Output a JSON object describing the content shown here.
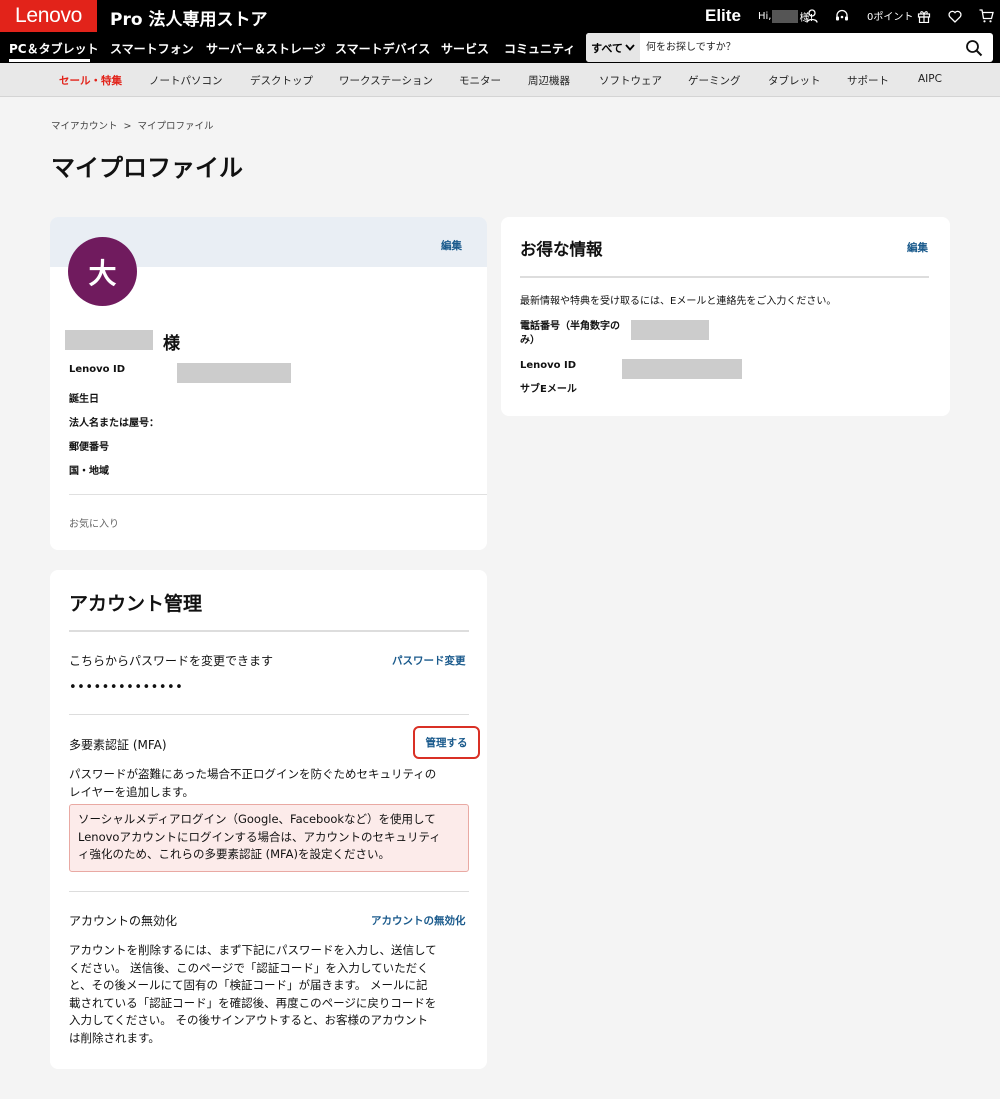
{
  "header": {
    "logo": "Lenovo",
    "store_title": "Pro 法人専用ストア",
    "elite": "Elite",
    "greeting_prefix": "Hi,",
    "greeting_suffix": "様!",
    "points": "0ポイント"
  },
  "nav": {
    "items": [
      "PC＆タブレット",
      "スマートフォン",
      "サーバー＆ストレージ",
      "スマートデバイス",
      "サービス",
      "コミュニティ"
    ]
  },
  "search": {
    "scope": "すべて",
    "placeholder": "何をお探しですか？"
  },
  "categories": [
    "セール・特集",
    "ノートパソコン",
    "デスクトップ",
    "ワークステーション",
    "モニター",
    "周辺機器",
    "ソフトウェア",
    "ゲーミング",
    "タブレット",
    "サポート",
    "AIPC"
  ],
  "breadcrumb": {
    "parent": "マイアカウント",
    "separator": ">",
    "current": "マイプロファイル"
  },
  "page_title": "マイプロファイル",
  "profile": {
    "edit": "編集",
    "avatar_initial": "大",
    "name_suffix": "様",
    "fields": [
      "Lenovo ID",
      "誕生日",
      "法人名または屋号：",
      "郵便番号",
      "国・地域"
    ],
    "favorites": "お気に入り"
  },
  "deals": {
    "title": "お得な情報",
    "edit": "編集",
    "intro": "最新情報や特典を受け取るには、Eメールと連絡先をご入力ください。",
    "phone_label_line1": "電話番号（半角数字の",
    "phone_label_line2": "み）",
    "lenovo_id_label": "Lenovo ID",
    "sub_email_label": "サブEメール"
  },
  "account": {
    "title": "アカウント管理",
    "password_text": "こちらからパスワードを変更できます",
    "password_link": "パスワード変更",
    "password_mask": "••••••••••••••",
    "mfa_title": "多要素認証 (MFA)",
    "mfa_button": "管理する",
    "mfa_desc_line1": "パスワードが盗難にあった場合不正ログインを防ぐためセキュリティの",
    "mfa_desc_line2": "レイヤーを追加します。",
    "notice_line1": "ソーシャルメディアログイン（Google、Facebookなど）を使用して",
    "notice_line2": "Lenovoアカウントにログインする場合は、アカウントのセキュリティ",
    "notice_line3": "ィ強化のため、これらの多要素認証 (MFA)を設定ください。",
    "deactivate_title": "アカウントの無効化",
    "deactivate_link": "アカウントの無効化",
    "deactivate_lines": [
      "アカウントを削除するには、まず下記にパスワードを入力し、送信して",
      "ください。 送信後、このページで「認証コード」を入力していただく",
      "と、その後メールにて固有の「検証コード」が届きます。 メールに記",
      "載されている「認証コード」を確認後、再度このページに戻りコードを",
      "入力してください。 その後サインアウトすると、お客様のアカウント",
      "は削除されます。"
    ]
  },
  "icons": {
    "user": "user-icon",
    "headset": "headset-icon",
    "gift": "gift-icon",
    "heart": "heart-icon",
    "cart": "cart-icon",
    "search": "search-icon",
    "chevron": "chevron-down-icon"
  },
  "colors": {
    "brand_red": "#e2231a",
    "avatar_purple": "#701b5e",
    "link_blue": "#1a5a8c",
    "highlight_border": "#d93025",
    "notice_bg": "#fcebea"
  }
}
